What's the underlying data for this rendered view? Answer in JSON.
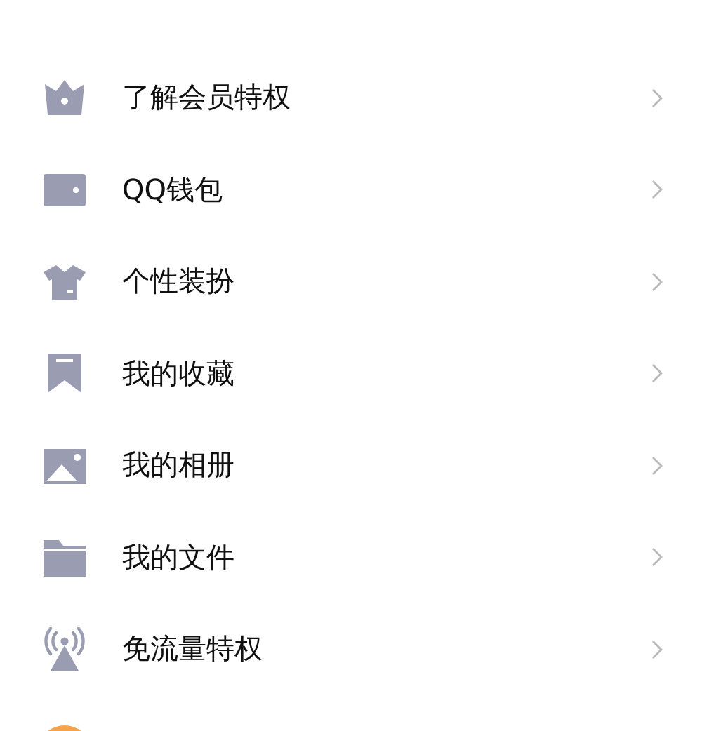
{
  "menu_items": [
    {
      "kind": "crown",
      "label": "了解会员特权"
    },
    {
      "kind": "wallet",
      "label": "QQ钱包"
    },
    {
      "kind": "shirt",
      "label": "个性装扮"
    },
    {
      "kind": "bookmark",
      "label": "我的收藏"
    },
    {
      "kind": "photo",
      "label": "我的相册"
    },
    {
      "kind": "folder",
      "label": "我的文件"
    },
    {
      "kind": "antenna",
      "label": "免流量特权"
    }
  ]
}
